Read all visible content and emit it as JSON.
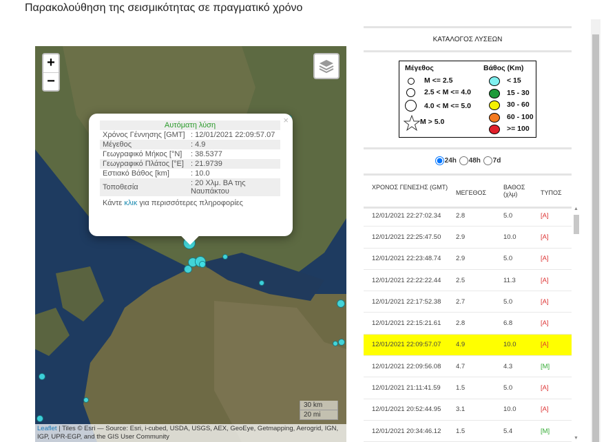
{
  "title": "Παρακολούθηση της σεισμικότητας σε πραγματικό χρόνο",
  "map": {
    "zoom_in": "+",
    "zoom_out": "−",
    "layers_icon": "layers-icon",
    "popup": {
      "header": "Αυτόματη λύση",
      "rows": [
        {
          "label": "Χρόνος Γέννησης [GMT]",
          "value": ": 12/01/2021 22:09:57.07"
        },
        {
          "label": "Μέγεθος",
          "value": ": 4.9"
        },
        {
          "label": "Γεωγραφικό Μήκος [°N]",
          "value": ": 38.5377"
        },
        {
          "label": "Γεωγραφικό Πλάτος [°E]",
          "value": ": 21.9739"
        },
        {
          "label": "Εστιακό Βάθος [km]",
          "value": ": 10.0"
        },
        {
          "label": "Τοποθεσία",
          "value": ": 20 Χλμ. ΒΑ της Ναυπάκτου"
        }
      ],
      "more_prefix": "Κάντε ",
      "more_link": "κλικ",
      "more_suffix": " για περισσότερες πληροφορίες",
      "close": "×"
    },
    "scale_km": "30 km",
    "scale_mi": "20 mi",
    "attr_link": "Leaflet",
    "attr_text": " | Tiles © Esri — Source: Esri, i-cubed, USDA, USGS, AEX, GeoEye, Getmapping, Aerogrid, IGN, IGP, UPR-EGP, and the GIS User Community"
  },
  "panel": {
    "catalog_title": "ΚΑΤΑΛΟΓΟΣ ΛΥΣΕΩΝ",
    "legend": {
      "size_title": "Μέγεθος",
      "sizes": [
        "M <= 2.5",
        "2.5 < M <= 4.0",
        "4.0 < M <= 5.0",
        "M > 5.0"
      ],
      "depth_title": "Βάθος (Km)",
      "depths": [
        {
          "label": "< 15",
          "color": "#7ff0f0"
        },
        {
          "label": "15 - 30",
          "color": "#1f9a3a"
        },
        {
          "label": "30 - 60",
          "color": "#f4f000"
        },
        {
          "label": "60 - 100",
          "color": "#f47a20"
        },
        {
          "label": ">= 100",
          "color": "#e0202a"
        }
      ]
    },
    "radios": [
      {
        "label": "24h",
        "checked": true
      },
      {
        "label": "48h",
        "checked": false
      },
      {
        "label": "7d",
        "checked": false
      }
    ],
    "columns": [
      "ΧΡΟΝΟΣ ΓΕΝΕΣΗΣ (GMT)",
      "ΜΕΓΕΘΟΣ",
      "ΒΑΘΟΣ (χλμ)",
      "ΤΥΠΟΣ"
    ],
    "rows": [
      {
        "time": "12/01/2021 22:27:02.34",
        "mag": "2.8",
        "depth": "5.0",
        "type": "[A]"
      },
      {
        "time": "12/01/2021 22:25:47.50",
        "mag": "2.9",
        "depth": "10.0",
        "type": "[A]"
      },
      {
        "time": "12/01/2021 22:23:48.74",
        "mag": "2.9",
        "depth": "5.0",
        "type": "[A]"
      },
      {
        "time": "12/01/2021 22:22:22.44",
        "mag": "2.5",
        "depth": "11.3",
        "type": "[A]"
      },
      {
        "time": "12/01/2021 22:17:52.38",
        "mag": "2.7",
        "depth": "5.0",
        "type": "[A]"
      },
      {
        "time": "12/01/2021 22:15:21.61",
        "mag": "2.8",
        "depth": "6.8",
        "type": "[A]"
      },
      {
        "time": "12/01/2021 22:09:57.07",
        "mag": "4.9",
        "depth": "10.0",
        "type": "[A]",
        "selected": true
      },
      {
        "time": "12/01/2021 22:09:56.08",
        "mag": "4.7",
        "depth": "4.3",
        "type": "[M]"
      },
      {
        "time": "12/01/2021 21:11:41.59",
        "mag": "1.5",
        "depth": "5.0",
        "type": "[A]"
      },
      {
        "time": "12/01/2021 20:52:44.95",
        "mag": "3.1",
        "depth": "10.0",
        "type": "[A]"
      },
      {
        "time": "12/01/2021 20:34:46.12",
        "mag": "1.5",
        "depth": "5.4",
        "type": "[M]"
      }
    ]
  }
}
